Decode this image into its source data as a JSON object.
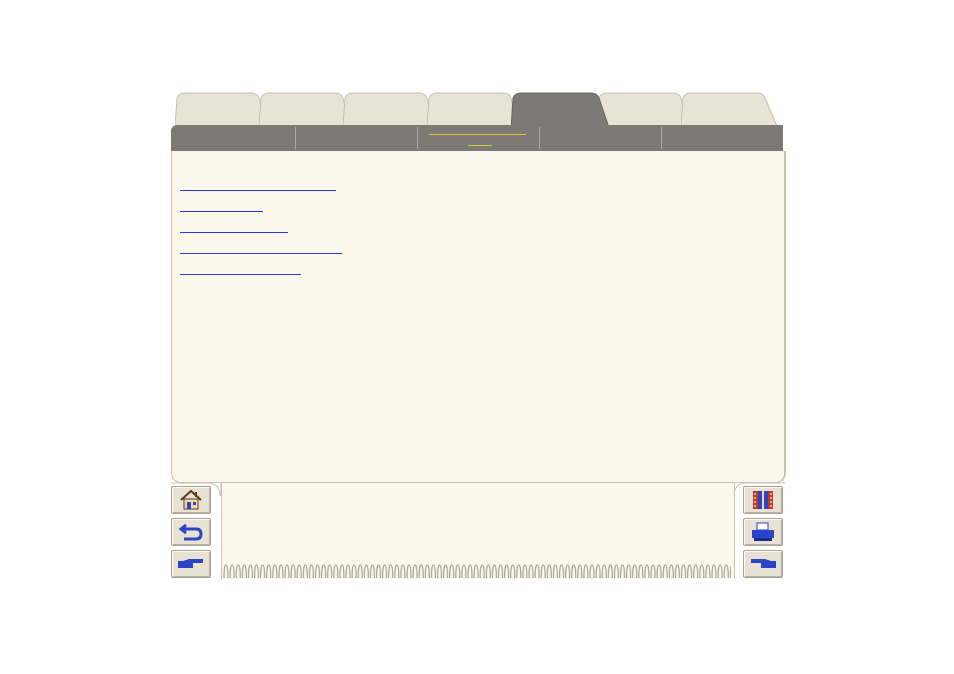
{
  "tabs": [
    {
      "label": "",
      "active": false
    },
    {
      "label": "",
      "active": false
    },
    {
      "label": "",
      "active": false
    },
    {
      "label": "",
      "active": false
    },
    {
      "label": "",
      "active": true
    },
    {
      "label": "",
      "active": false
    },
    {
      "label": "",
      "active": false
    }
  ],
  "subnav": {
    "items": [
      {
        "label": ""
      },
      {
        "label": ""
      },
      {
        "label": "",
        "active": true
      },
      {
        "label": ""
      },
      {
        "label": ""
      }
    ]
  },
  "links": [
    {
      "label": ""
    },
    {
      "label": ""
    },
    {
      "label": ""
    },
    {
      "label": ""
    },
    {
      "label": ""
    }
  ],
  "nav_left": {
    "home_icon": "home-icon",
    "back_icon": "return-arrow-icon",
    "forward_icon": "pointing-hand-right-icon"
  },
  "nav_right": {
    "index_icon": "book-icon",
    "print_icon": "printer-icon",
    "previous_icon": "pointing-hand-left-icon"
  },
  "colors": {
    "tab_inactive": "#e8e3d4",
    "tab_active": "#7b7a74",
    "page_bg": "#fcf6ec",
    "link": "#2b37d8",
    "active_underline": "#e6c23a",
    "icon_blue": "#2d43c8"
  }
}
